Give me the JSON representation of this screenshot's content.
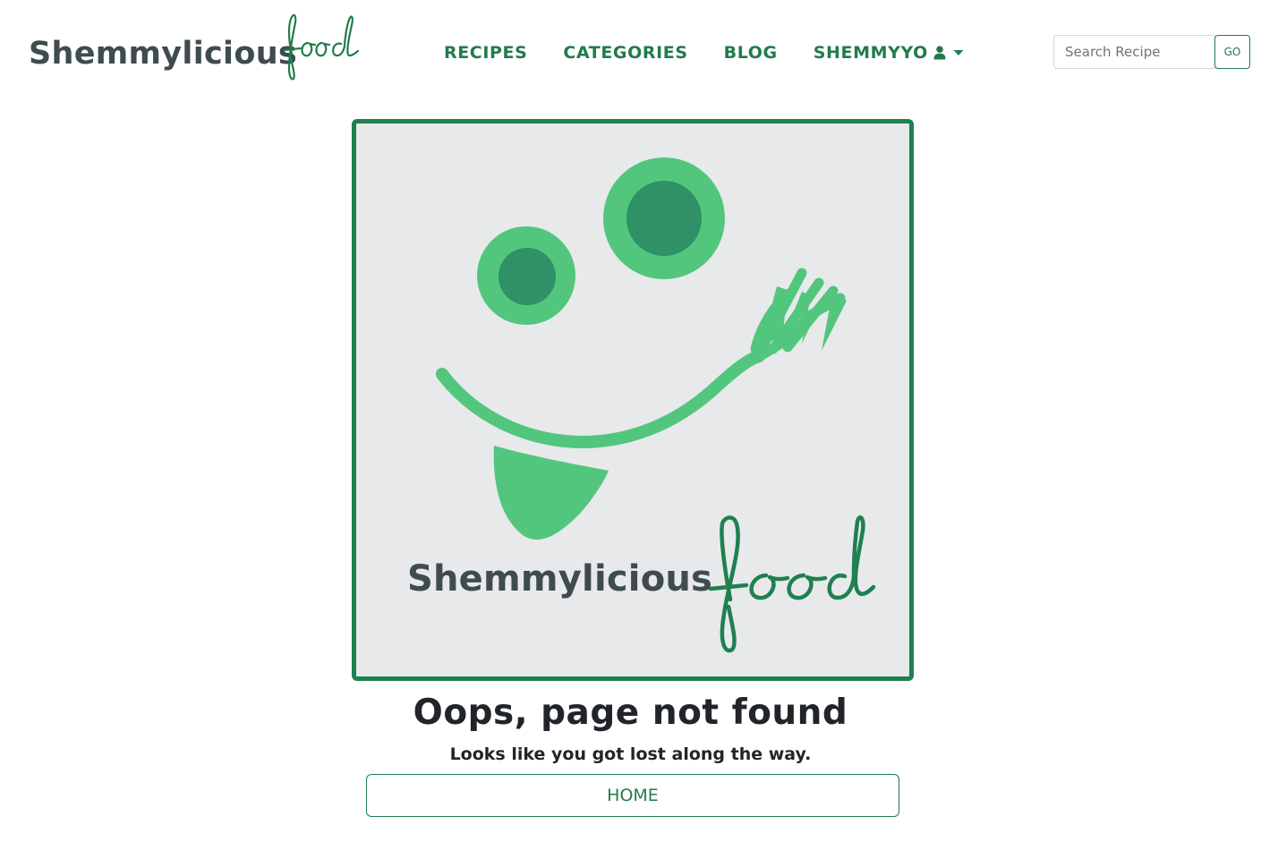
{
  "navbar": {
    "brand_main": "Shemmylicious",
    "brand_script": "food",
    "links": {
      "recipes": "RECIPES",
      "categories": "CATEGORIES",
      "blog": "BLOG",
      "user": "SHEMMYYO"
    },
    "search": {
      "placeholder": "Search Recipe",
      "value": "",
      "button_label": "GO"
    }
  },
  "main": {
    "logo": {
      "wordmark": "Shemmylicious",
      "script": "food"
    },
    "title": "Oops, page not found",
    "subtitle": "Looks like you got lost along the way.",
    "home_button": "HOME"
  },
  "colors": {
    "brand_green": "#227b4c",
    "border_green": "#1f8050",
    "light_green": "#52c67d",
    "dark_green": "#2f9165",
    "slate": "#3e4b4f",
    "logo_bg": "#e8e9eb"
  },
  "icons": {
    "user": "user-icon",
    "caret": "caret-down-icon"
  }
}
